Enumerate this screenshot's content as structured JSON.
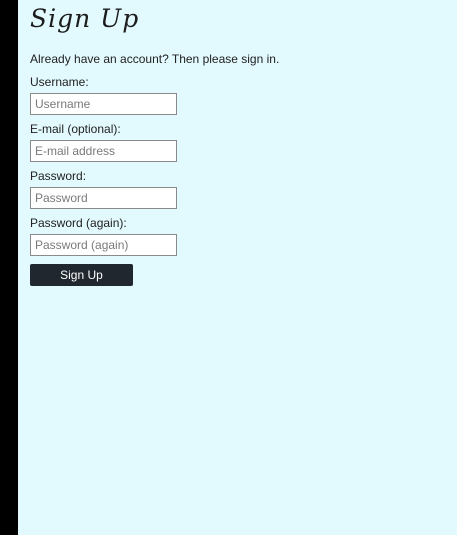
{
  "form": {
    "title": "Sign Up",
    "intro": "Already have an account? Then please sign in.",
    "fields": [
      {
        "label": "Username:",
        "placeholder": "Username",
        "value": ""
      },
      {
        "label": "E-mail (optional):",
        "placeholder": "E-mail address",
        "value": ""
      },
      {
        "label": "Password:",
        "placeholder": "Password",
        "value": ""
      },
      {
        "label": "Password (again):",
        "placeholder": "Password (again)",
        "value": ""
      }
    ],
    "submit_label": "Sign Up"
  },
  "colors": {
    "page_background": "#e2f9fd",
    "left_strip": "#000000",
    "button_background": "#20272f",
    "button_text": "#ffffff"
  }
}
